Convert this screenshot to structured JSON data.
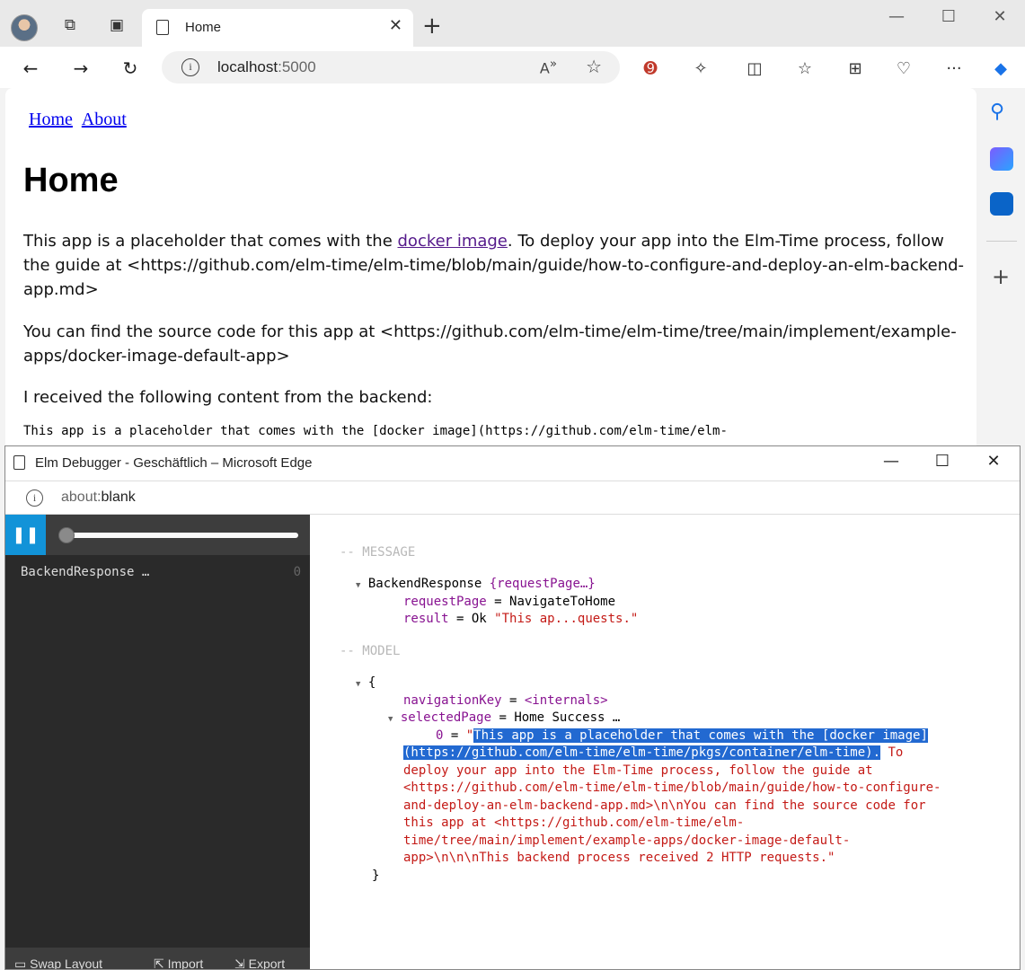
{
  "browser": {
    "tab_title": "Home",
    "url_host": "localhost",
    "url_port": ":5000"
  },
  "page": {
    "nav_links": [
      "Home",
      "About"
    ],
    "heading": "Home",
    "p1_before": "This app is a placeholder that comes with the ",
    "p1_link": "docker image",
    "p1_after": ". To deploy your app into the Elm-Time process, follow the guide at <https://github.com/elm-time/elm-time/blob/main/guide/how-to-configure-and-deploy-an-elm-backend-app.md>",
    "p2": "You can find the source code for this app at <https://github.com/elm-time/elm-time/tree/main/implement/example-apps/docker-image-default-app>",
    "p3": "I received the following content from the backend:",
    "pre_line": "This app is a placeholder that comes with the [docker image](https://github.com/elm-time/elm-"
  },
  "debugger": {
    "window_title": "Elm Debugger - Geschäftlich – Microsoft Edge",
    "url_scheme": "about:",
    "url_rest": "blank",
    "messages": [
      {
        "label": "BackendResponse …",
        "index": "0"
      }
    ],
    "bottom": {
      "swap": "Swap Layout",
      "import": "Import",
      "export": "Export"
    },
    "message_header": "-- MESSAGE",
    "model_header": "-- MODEL",
    "msg_ctor": "BackendResponse",
    "msg_summary": "{requestPage…}",
    "msg_field1_key": "requestPage",
    "msg_field1_val": "NavigateToHome",
    "msg_field2_key": "result",
    "msg_field2_val": "Ok",
    "msg_field2_str": "\"This ap...quests.\"",
    "model_open": "{",
    "model_field1_key": "navigationKey",
    "model_field1_val": "<internals>",
    "model_field2_key": "selectedPage",
    "model_field2_val": "Home Success …",
    "model_item_key": "0",
    "model_str_lines": [
      "This app is a placeholder that comes with the [docker image]",
      "(https://github.com/elm-time/elm-time/pkgs/container/elm-time).",
      " To",
      "deploy your app into the Elm-Time process, follow the guide at",
      "<https://github.com/elm-time/elm-time/blob/main/guide/how-to-configure-",
      "and-deploy-an-elm-backend-app.md>\\n\\nYou can find the source code for",
      "this app at <https://github.com/elm-time/elm-",
      "time/tree/main/implement/example-apps/docker-image-default-",
      "app>\\n\\n\\nThis backend process received 2 HTTP requests.\""
    ],
    "model_close": "}"
  }
}
